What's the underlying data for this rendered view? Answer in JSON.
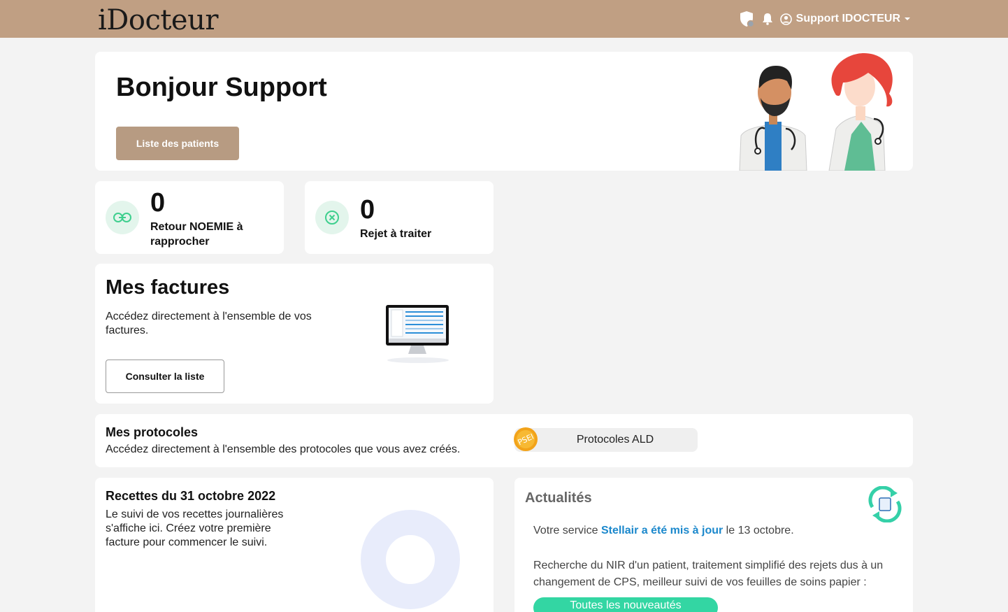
{
  "header": {
    "logo": "iDocteur",
    "user_name": "Support IDOCTEUR"
  },
  "welcome": {
    "title": "Bonjour Support",
    "patients_button": "Liste des patients"
  },
  "stats": [
    {
      "value": "0",
      "label": "Retour NOEMIE à rapprocher"
    },
    {
      "value": "0",
      "label": "Rejet à traiter"
    }
  ],
  "invoices": {
    "title": "Mes factures",
    "description": "Accédez directement à l'ensemble de vos factures.",
    "button": "Consulter la liste"
  },
  "protocols": {
    "title": "Mes protocoles",
    "description": "Accédez directement à l'ensemble des protocoles que vous avez créés.",
    "badge": "PSEI",
    "ald_label": "Protocoles ALD"
  },
  "revenue": {
    "title": "Recettes du 31 octobre 2022",
    "description": "Le suivi de vos recettes journalières s'affiche ici. Créez votre première facture pour commencer le suivi."
  },
  "news": {
    "title": "Actualités",
    "prefix": "Votre service ",
    "link": "Stellair a été mis à jour",
    "suffix": " le 13 octobre.",
    "body": "Recherche du NIR d'un patient, traitement simplifié des rejets dus à un changement de CPS, meilleur suivi de vos feuilles de soins papier :",
    "button": "Toutes les nouveautés"
  },
  "colors": {
    "header_bg": "#c09f83",
    "primary_button": "#b79b82",
    "accent_green": "#33d6a3",
    "link_blue": "#1b88cc",
    "donut": "#e8ecfb"
  }
}
